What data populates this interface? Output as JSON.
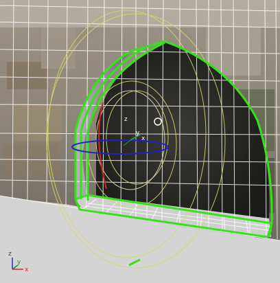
{
  "viewport": {
    "gizmo_labels": {
      "z": "z",
      "y": "y",
      "x": "x"
    },
    "axis_tripod": {
      "z": "z",
      "y": "y",
      "x": "x"
    }
  },
  "colors": {
    "ground": "#d4d4d4",
    "wireframe": "#ffffff",
    "selection": "#35e21a",
    "light_helper": "#d8d46a",
    "gizmo_red": "#d42a1a",
    "gizmo_blue": "#2020c8",
    "gizmo_green": "#2a9a2a",
    "tripod_x": "#e0202a",
    "tripod_y": "#2a8a2a",
    "tripod_z": "#2a2ad0"
  },
  "icons": [
    "rotate-gizmo-icon",
    "axis-tripod-icon"
  ]
}
